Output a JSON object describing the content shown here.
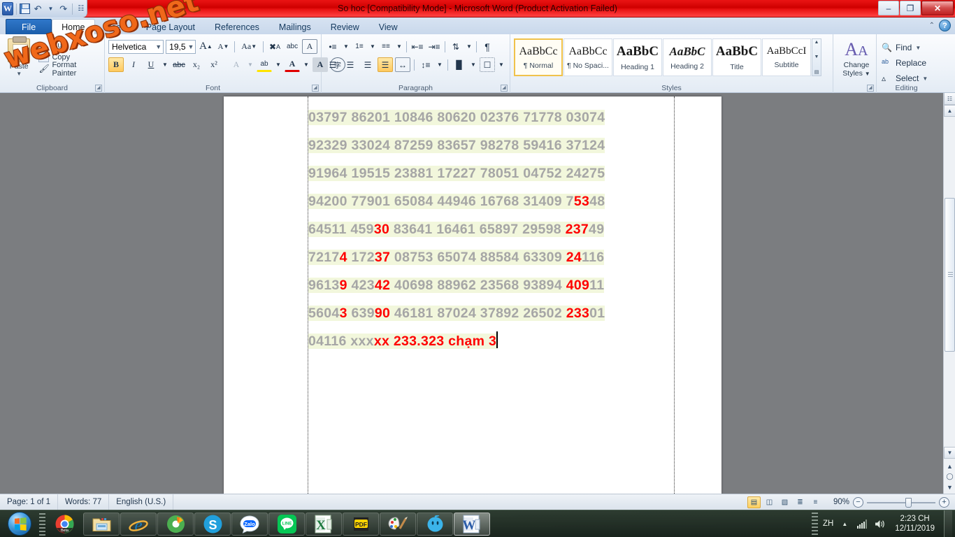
{
  "window": {
    "title": "So hoc [Compatibility Mode]  -  Microsoft Word (Product Activation Failed)",
    "minimize": "–",
    "restore": "❐",
    "close": "✕"
  },
  "watermark": {
    "text": "webxoso.net",
    "color": "#f0681a"
  },
  "quick_access": {
    "app_logo": "W",
    "save": "save-icon",
    "undo": "↶",
    "redo": "↷",
    "customize": "☷"
  },
  "tabs": [
    {
      "label": "File",
      "state": "file"
    },
    {
      "label": "Home",
      "state": "active"
    },
    {
      "label": "Insert",
      "state": ""
    },
    {
      "label": "Page Layout",
      "state": ""
    },
    {
      "label": "References",
      "state": ""
    },
    {
      "label": "Mailings",
      "state": ""
    },
    {
      "label": "Review",
      "state": ""
    },
    {
      "label": "View",
      "state": ""
    }
  ],
  "help": {
    "minimize_ribbon": "⌃",
    "help": "?"
  },
  "ribbon": {
    "clipboard": {
      "group_label": "Clipboard",
      "paste_label": "Paste",
      "cut_label": "Cut",
      "copy_label": "Copy",
      "format_painter_label": "Format Painter"
    },
    "font": {
      "group_label": "Font",
      "font_name": "Helvetica",
      "font_size": "19,5",
      "grow_font": "A",
      "shrink_font": "A",
      "change_case": "Aa",
      "clear_formatting": "clear-formatting-icon",
      "text_effects": "abc",
      "bold": "B",
      "italic": "I",
      "underline": "U",
      "strikethrough": "abc",
      "subscript": "x₂",
      "superscript": "x²",
      "text_highlight": "ab",
      "font_color": "A",
      "character_shading": "A",
      "enclose_characters": "字",
      "bold_active": true
    },
    "paragraph": {
      "group_label": "Paragraph",
      "bullets": "bullet-list-icon",
      "numbering": "numbered-list-icon",
      "multilevel": "multilevel-list-icon",
      "decrease_indent": "decrease-indent-icon",
      "increase_indent": "increase-indent-icon",
      "sort": "sort-icon",
      "show_marks": "¶",
      "align_left": "align-left-icon",
      "align_center": "align-center-icon",
      "align_right": "align-right-icon",
      "justify": "justify-icon",
      "distributed": "distributed-icon",
      "line_spacing": "line-spacing-icon",
      "shading": "shading-icon",
      "borders": "borders-icon",
      "justify_active": true
    },
    "styles": {
      "group_label": "Styles",
      "items": [
        {
          "preview": "AaBbCc",
          "name": "¶ Normal",
          "selected": true,
          "style": "normal"
        },
        {
          "preview": "AaBbCc",
          "name": "¶ No Spaci...",
          "selected": false,
          "style": "normal"
        },
        {
          "preview": "AaBbC",
          "name": "Heading 1",
          "selected": false,
          "style": "h1"
        },
        {
          "preview": "AaBbC",
          "name": "Heading 2",
          "selected": false,
          "style": "h2"
        },
        {
          "preview": "AaBbC",
          "name": "Title",
          "selected": false,
          "style": "title"
        },
        {
          "preview": "AaBbCcI",
          "name": "Subtitle",
          "selected": false,
          "style": "sub"
        }
      ],
      "change_styles_label": "Change\nStyles"
    },
    "editing": {
      "group_label": "Editing",
      "find": "Find",
      "replace": "Replace",
      "select": "Select"
    }
  },
  "document": {
    "lines": [
      [
        {
          "t": "03797 86201 10846 80620 02376 71778 03074",
          "c": "g"
        }
      ],
      [
        {
          "t": "92329 33024 87259 83657 98278 59416 37124",
          "c": "g"
        }
      ],
      [
        {
          "t": "91964 19515 23881 17227 78051 04752 24275",
          "c": "g"
        }
      ],
      [
        {
          "t": "94200 77901 65084 44946 16768 31409 7",
          "c": "g"
        },
        {
          "t": "53",
          "c": "r"
        },
        {
          "t": "48",
          "c": "g"
        }
      ],
      [
        {
          "t": "64511 459",
          "c": "g"
        },
        {
          "t": "30",
          "c": "r"
        },
        {
          "t": " 83641 16461 65897 29598 ",
          "c": "g"
        },
        {
          "t": "237",
          "c": "r"
        },
        {
          "t": "49",
          "c": "g"
        }
      ],
      [
        {
          "t": "7217",
          "c": "g"
        },
        {
          "t": "4",
          "c": "r"
        },
        {
          "t": " 172",
          "c": "g"
        },
        {
          "t": "37",
          "c": "r"
        },
        {
          "t": " 08753 65074 88584 63309 ",
          "c": "g"
        },
        {
          "t": "24",
          "c": "r"
        },
        {
          "t": "116",
          "c": "g"
        }
      ],
      [
        {
          "t": "9613",
          "c": "g"
        },
        {
          "t": "9",
          "c": "r"
        },
        {
          "t": " 423",
          "c": "g"
        },
        {
          "t": "42",
          "c": "r"
        },
        {
          "t": " 40698 88962 23568 93894 ",
          "c": "g"
        },
        {
          "t": "409",
          "c": "r"
        },
        {
          "t": "11",
          "c": "g"
        }
      ],
      [
        {
          "t": "5604",
          "c": "g"
        },
        {
          "t": "3",
          "c": "r"
        },
        {
          "t": " 639",
          "c": "g"
        },
        {
          "t": "90",
          "c": "r"
        },
        {
          "t": " 46181 87024 37892 26502 ",
          "c": "g"
        },
        {
          "t": "233",
          "c": "r"
        },
        {
          "t": "01",
          "c": "g"
        }
      ],
      [
        {
          "t": "04116 xxx",
          "c": "g"
        },
        {
          "t": "xx ",
          "c": "r"
        },
        {
          "t": "233.323 chạm 3",
          "c": "r"
        }
      ]
    ],
    "text_color_normal": "#a6a6a6",
    "text_color_highlight": "#ff0000",
    "highlight_background": "#f2f7dc"
  },
  "status_bar": {
    "page": "Page: 1 of 1",
    "words": "Words: 77",
    "language": "English (U.S.)",
    "views": [
      {
        "name": "print-layout-view",
        "glyph": "▤",
        "active": true
      },
      {
        "name": "full-screen-reading-view",
        "glyph": "◫",
        "active": false
      },
      {
        "name": "web-layout-view",
        "glyph": "▧",
        "active": false
      },
      {
        "name": "outline-view",
        "glyph": "≣",
        "active": false
      },
      {
        "name": "draft-view",
        "glyph": "≡",
        "active": false
      }
    ],
    "zoom": "90%",
    "zoom_out": "−",
    "zoom_in": "+"
  },
  "taskbar": {
    "start": "start-orb",
    "items": [
      {
        "name": "taskbar-chrome",
        "label": "Beta",
        "kind": "chrome"
      },
      {
        "name": "taskbar-file-explorer",
        "label": "",
        "kind": "explorer"
      },
      {
        "name": "taskbar-internet-explorer",
        "label": "e",
        "kind": "ie"
      },
      {
        "name": "taskbar-unikey",
        "label": "",
        "kind": "green"
      },
      {
        "name": "taskbar-skype",
        "label": "S",
        "kind": "skype"
      },
      {
        "name": "taskbar-zalo",
        "label": "Zalo",
        "kind": "zalo"
      },
      {
        "name": "taskbar-line",
        "label": "LINE",
        "kind": "line"
      },
      {
        "name": "taskbar-excel",
        "label": "X",
        "kind": "excel"
      },
      {
        "name": "taskbar-pdf-reader",
        "label": "PDF",
        "kind": "pdf"
      },
      {
        "name": "taskbar-paint",
        "label": "",
        "kind": "paint"
      },
      {
        "name": "taskbar-bluestacks",
        "label": "",
        "kind": "blue"
      },
      {
        "name": "taskbar-word",
        "label": "W",
        "kind": "word"
      }
    ],
    "tray": {
      "input_language": "ZH",
      "show_hidden": "▲",
      "network": "network-icon",
      "volume": "volume-icon",
      "time": "2:23 CH",
      "date": "12/11/2019"
    }
  }
}
